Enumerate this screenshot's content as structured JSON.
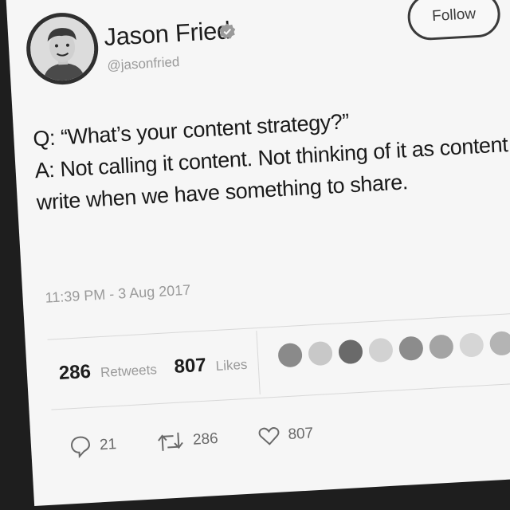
{
  "author": {
    "name": "Jason Fried",
    "handle": "@jasonfried",
    "verified": true
  },
  "header": {
    "follow_label": "Follow"
  },
  "tweet": {
    "lines": [
      "Q: “What’s your content strategy?”",
      "A: Not calling it content. Not thinking of it as content. We",
      "write when we have something to share."
    ],
    "timestamp": "11:39 PM - 3 Aug 2017"
  },
  "stats": {
    "retweets_count": "286",
    "retweets_label": "Retweets",
    "likes_count": "807",
    "likes_label": "Likes"
  },
  "liker_avatars": [
    "#8a8a8a",
    "#c8c8c8",
    "#6a6a6a",
    "#d2d2d2",
    "#8c8c8c",
    "#a4a4a4",
    "#d6d6d6",
    "#b4b4b4",
    "#1a1a1a"
  ],
  "actions": {
    "reply_count": "21",
    "retweet_count": "286",
    "like_count": "807"
  },
  "icons": [
    "verified-badge-icon",
    "reply-icon",
    "retweet-icon",
    "heart-icon"
  ]
}
